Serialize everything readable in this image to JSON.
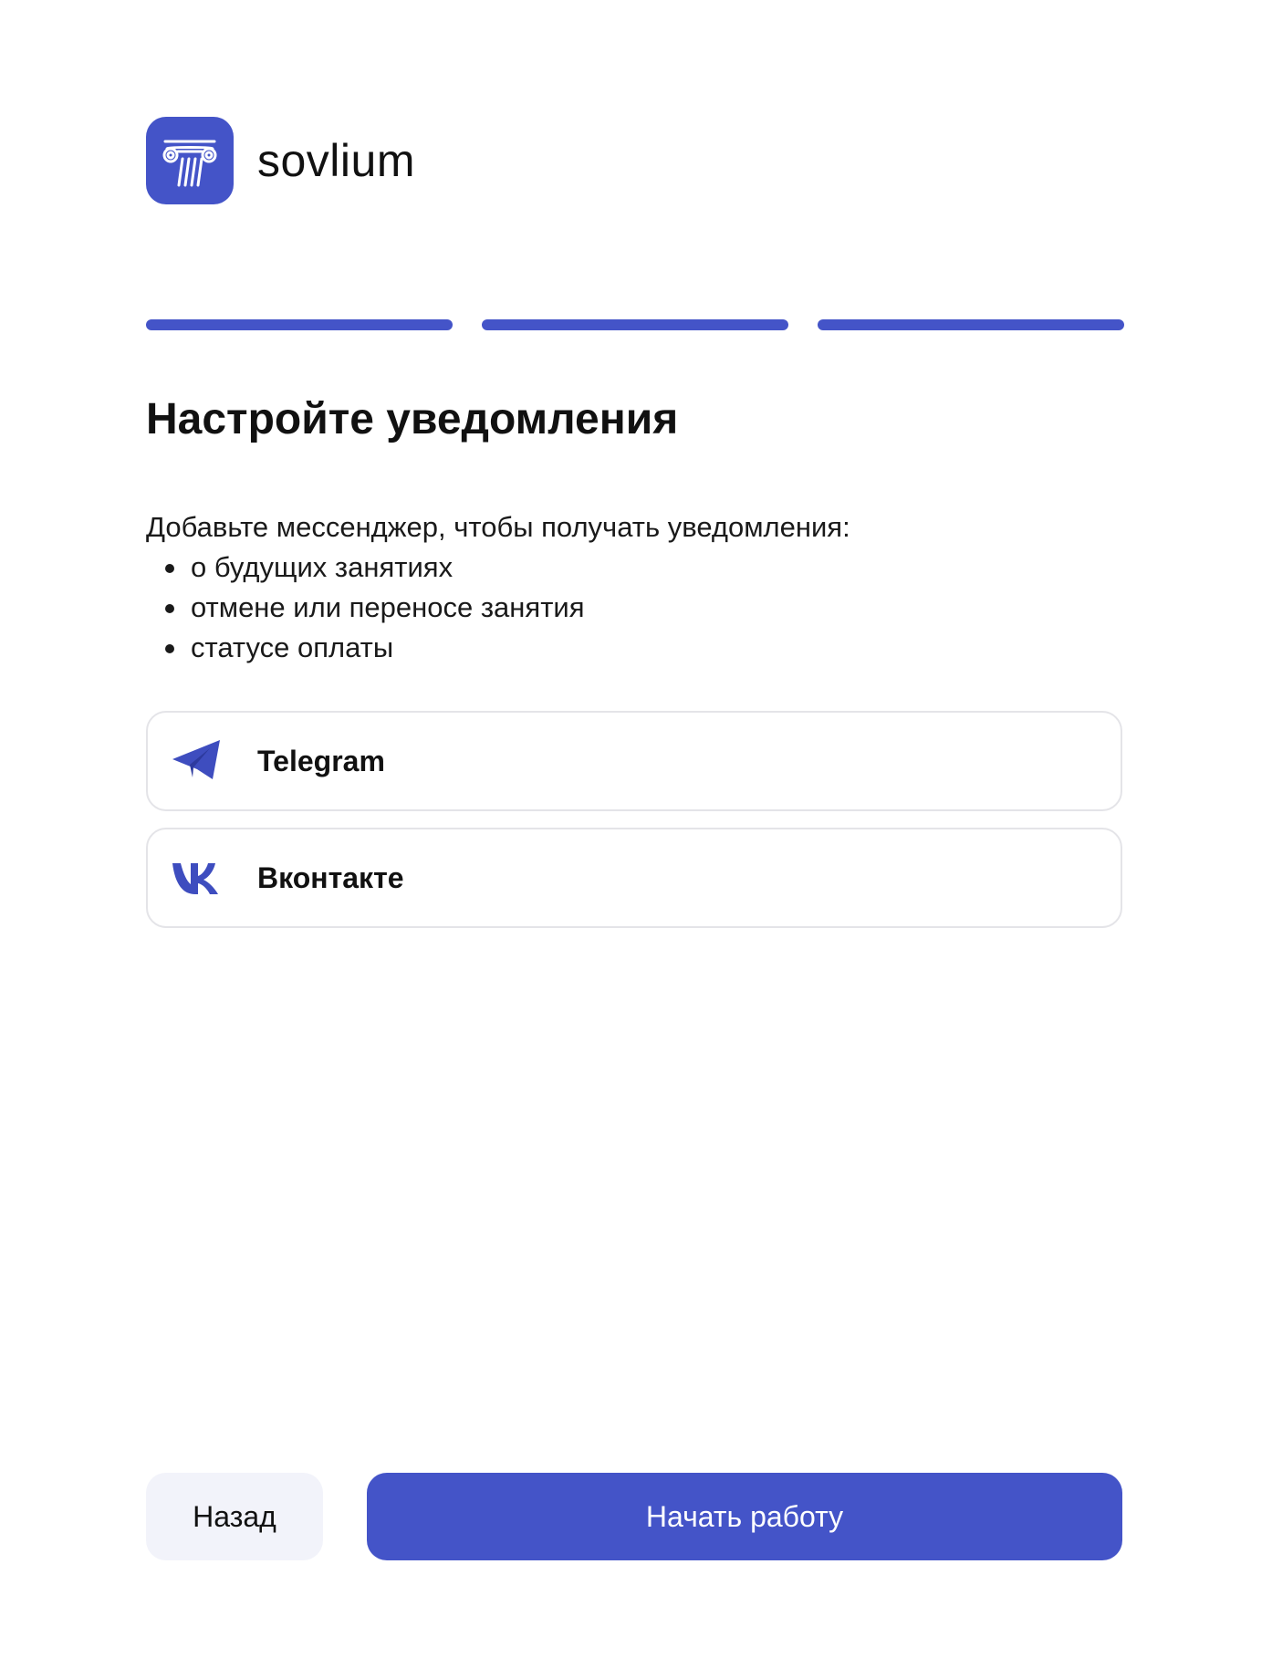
{
  "brand": {
    "name": "sovlium",
    "logo_icon": "column-icon",
    "logo_color": "#4454c8"
  },
  "progress": {
    "current_step": 3,
    "total_steps": 3,
    "active_color": "#4454c8"
  },
  "page": {
    "title": "Настройте уведомления",
    "intro": "Добавьте мессенджер, чтобы получать уведомления:",
    "bullets": [
      "о будущих занятиях",
      "отмене или переносе занятия",
      "статусе оплаты"
    ]
  },
  "options": [
    {
      "label": "Telegram",
      "icon": "telegram-icon"
    },
    {
      "label": "Вконтакте",
      "icon": "vk-icon"
    }
  ],
  "actions": {
    "back_label": "Назад",
    "start_label": "Начать работу",
    "primary_color": "#4454c8"
  }
}
